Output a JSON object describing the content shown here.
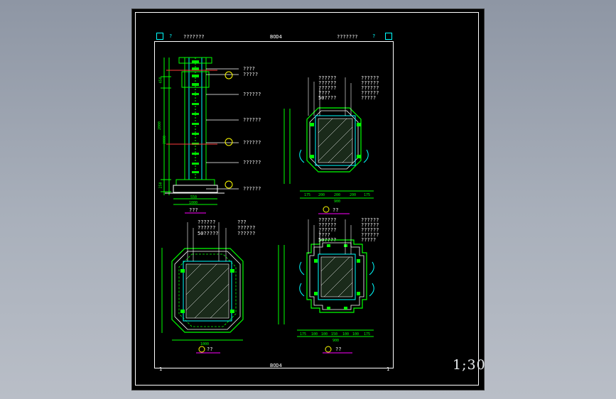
{
  "header": {
    "left_label": "???????",
    "center_code": "BOD4",
    "right_label": "???????",
    "question_mark": "?"
  },
  "footer": {
    "left_number": "1",
    "center_code": "BOD4",
    "right_number": "1"
  },
  "scale": "1;30",
  "elevation": {
    "caption": "???",
    "callouts": [
      "????",
      "?????",
      "??????",
      "??????",
      "??????",
      "??????",
      "??????"
    ],
    "dims_vertical": [
      "450",
      "2000",
      "2000",
      "250"
    ],
    "dims_horizontal": [
      "550",
      "1000"
    ]
  },
  "section_a": {
    "caption": "??",
    "callouts_left": [
      "??????",
      "??????",
      "??????",
      "????",
      "50????"
    ],
    "callouts_right": [
      "??????",
      "??????",
      "??????",
      "??????",
      "?????"
    ],
    "dims_bottom": [
      "175",
      "200",
      "200",
      "200",
      "175"
    ],
    "total": "900"
  },
  "section_b": {
    "caption": "??",
    "callouts_left": [
      "??????",
      "??????",
      "50?????"
    ],
    "callouts_right": [
      "???",
      "??????",
      "??????"
    ],
    "width_dim": "1000"
  },
  "section_c": {
    "caption": "??",
    "callouts_left": [
      "??????",
      "??????",
      "??????",
      "????",
      "50????"
    ],
    "callouts_right": [
      "??????",
      "??????",
      "??????",
      "??????",
      "?????"
    ],
    "dims_bottom": [
      "175",
      "100",
      "100",
      "150",
      "100",
      "100",
      "175"
    ],
    "total": "900"
  },
  "colors": {
    "outline_white": "#ffffff",
    "concrete_green": "#00ff00",
    "cyan": "#00ffff",
    "yellow": "#ffff00",
    "magenta": "#ff00ff",
    "red": "#ff3b3b"
  }
}
